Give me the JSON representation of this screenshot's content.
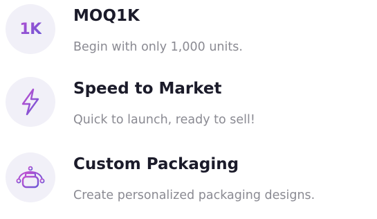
{
  "features": [
    {
      "icon": "1k-badge-icon",
      "icon_text": "1K",
      "title": "MOQ1K",
      "description": "Begin with only 1,000 units."
    },
    {
      "icon": "lightning-bolt-icon",
      "title": "Speed to Market",
      "description": "Quick to launch, ready to sell!"
    },
    {
      "icon": "packaging-design-icon",
      "title": "Custom Packaging",
      "description": "Create personalized packaging designs."
    }
  ],
  "colors": {
    "icon_background": "#f1f0f8",
    "icon_gradient_start": "#b14fd2",
    "icon_gradient_end": "#6a57d6",
    "title": "#1b1b2a",
    "description": "#8a8a92"
  }
}
